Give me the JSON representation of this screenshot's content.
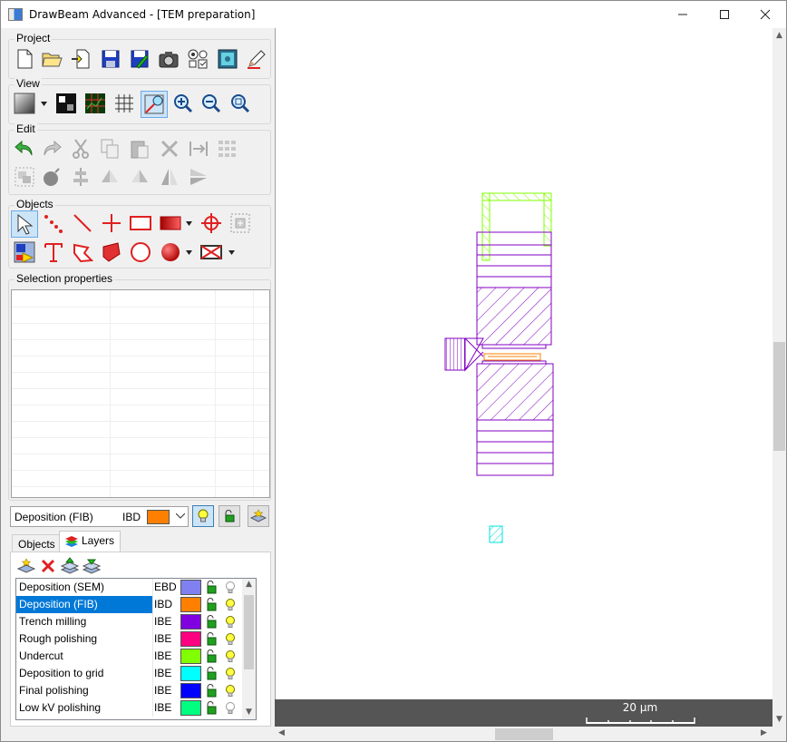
{
  "window": {
    "title": "DrawBeam Advanced - [TEM preparation]",
    "minimize_icon": "minimize-icon",
    "maximize_icon": "maximize-icon",
    "close_icon": "close-icon"
  },
  "groups": {
    "project": "Project",
    "view": "View",
    "edit": "Edit",
    "objects": "Objects",
    "selection_properties": "Selection properties"
  },
  "toolbar_icons": {
    "project": [
      "new-file-icon",
      "open-folder-icon",
      "import-icon",
      "save-icon",
      "save-as-icon",
      "camera-icon",
      "view-options-icon",
      "edit-pen-icon"
    ],
    "view": [
      "background-image-icon",
      "contrast-icon",
      "grid-overlay-icon",
      "grid-icon",
      "measure-icon",
      "zoom-in-icon",
      "zoom-out-icon",
      "zoom-fit-icon"
    ],
    "edit": [
      "undo-icon",
      "redo-icon",
      "cut-icon",
      "copy-icon",
      "paste-icon",
      "delete-icon",
      "align-icon",
      "array-icon",
      "group-icon",
      "bomb-icon",
      "center-icon",
      "rotate-icon",
      "rotate-ccw-icon",
      "flip-icon",
      "shear-icon"
    ],
    "objects": [
      "pointer-icon",
      "points-icon",
      "line-icon",
      "cross-icon",
      "rectangle-icon",
      "filled-rectangle-icon",
      "target-icon",
      "snap-icon",
      "layer-fill-icon",
      "text-icon",
      "polygon-icon",
      "filled-polygon-icon",
      "circle-icon",
      "filled-circle-icon",
      "cross-section-icon"
    ]
  },
  "current_layer": {
    "name": "Deposition (FIB)",
    "type": "IBD",
    "color": "#ff8000"
  },
  "tabs": [
    "Objects",
    "Layers"
  ],
  "selected_tab": "Layers",
  "layers": [
    {
      "name": "Deposition (SEM)",
      "type": "EBD",
      "color": "#8080f0",
      "visible": false
    },
    {
      "name": "Deposition (FIB)",
      "type": "IBD",
      "color": "#ff8000",
      "visible": true
    },
    {
      "name": "Trench milling",
      "type": "IBE",
      "color": "#8000e0",
      "visible": true
    },
    {
      "name": "Rough polishing",
      "type": "IBE",
      "color": "#ff0080",
      "visible": true
    },
    {
      "name": "Undercut",
      "type": "IBE",
      "color": "#80ff00",
      "visible": true
    },
    {
      "name": "Deposition to grid",
      "type": "IBE",
      "color": "#00ffff",
      "visible": true
    },
    {
      "name": "Final polishing",
      "type": "IBE",
      "color": "#0000ff",
      "visible": true
    },
    {
      "name": "Low kV polishing",
      "type": "IBE",
      "color": "#00ff80",
      "visible": false
    }
  ],
  "scale": {
    "label": "20 µm"
  },
  "colors": {
    "trench": "#8000c0",
    "deposition_fib": "#ff8000",
    "undercut": "#80ff00",
    "deposition_grid": "#00e0e0"
  }
}
